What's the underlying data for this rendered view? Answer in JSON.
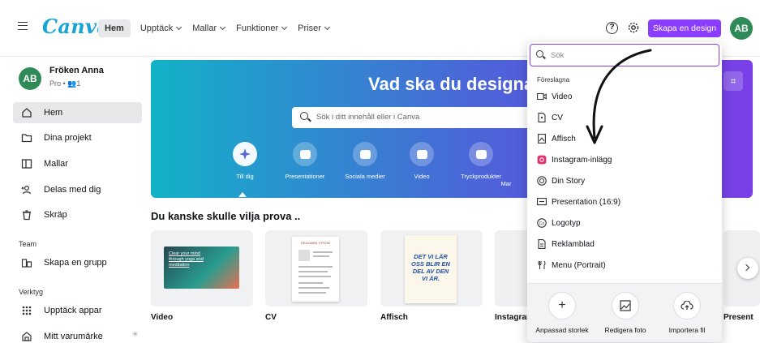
{
  "topbar": {
    "logo": "Canva",
    "nav": [
      {
        "label": "Hem",
        "active": true
      },
      {
        "label": "Upptäck",
        "has_chevron": true
      },
      {
        "label": "Mallar",
        "has_chevron": true
      },
      {
        "label": "Funktioner",
        "has_chevron": true
      },
      {
        "label": "Priser",
        "has_chevron": true
      }
    ],
    "help_icon": "?",
    "create_button": "Skapa en design",
    "avatar_initials": "AB"
  },
  "sidebar": {
    "user_initials": "AB",
    "user_name": "Fröken Anna",
    "user_sub": "Pro • 👥1",
    "items": [
      {
        "label": "Hem",
        "icon": "home-icon",
        "active": true
      },
      {
        "label": "Dina projekt",
        "icon": "folder-icon"
      },
      {
        "label": "Mallar",
        "icon": "templates-icon"
      },
      {
        "label": "Delas med dig",
        "icon": "shared-users-icon"
      },
      {
        "label": "Skräp",
        "icon": "trash-icon"
      }
    ],
    "team_heading": "Team",
    "team_items": [
      {
        "label": "Skapa en grupp",
        "icon": "team-building-icon"
      }
    ],
    "tools_heading": "Verktyg",
    "tools_items": [
      {
        "label": "Upptäck appar",
        "icon": "apps-grid-icon"
      },
      {
        "label": "Mitt varumärke",
        "icon": "brand-icon"
      }
    ]
  },
  "hero": {
    "title": "Vad ska du designa?",
    "search_placeholder": "Sök i ditt innehåll eller i Canva",
    "categories": [
      {
        "label": "Till dig",
        "icon": "sparkle-icon"
      },
      {
        "label": "Presentationer",
        "icon": "presentation-icon"
      },
      {
        "label": "Sociala medier",
        "icon": "heart-chat-icon"
      },
      {
        "label": "Video",
        "icon": "video-camera-icon"
      },
      {
        "label": "Tryckprodukter",
        "icon": "printer-icon"
      },
      {
        "label": "Mar"
      }
    ]
  },
  "suggestions": {
    "title": "Du kanske skulle vilja prova ..",
    "cards": [
      {
        "label": "Video",
        "thumb_text": "Clear your mind through yoga and meditation"
      },
      {
        "label": "CV",
        "thumb_text": "BENJAMIN STRÖM"
      },
      {
        "label": "Affisch",
        "thumb_text": "DET VI LÄR OSS BLIR EN DEL AV DEN VI ÄR."
      },
      {
        "label": "Instagram"
      },
      {
        "label": "Present"
      }
    ]
  },
  "dropdown": {
    "search_placeholder": "Sök",
    "heading": "Föreslagna",
    "items": [
      {
        "label": "Video",
        "icon": "video-icon"
      },
      {
        "label": "CV",
        "icon": "document-icon"
      },
      {
        "label": "Affisch",
        "icon": "poster-icon"
      },
      {
        "label": "Instagram-inlägg",
        "icon": "instagram-icon"
      },
      {
        "label": "Din Story",
        "icon": "story-icon"
      },
      {
        "label": "Presentation (16:9)",
        "icon": "presentation-icon"
      },
      {
        "label": "Logotyp",
        "icon": "logo-icon"
      },
      {
        "label": "Reklamblad",
        "icon": "flyer-icon"
      },
      {
        "label": "Menu (Portrait)",
        "icon": "menu-cutlery-icon"
      }
    ],
    "footer": [
      {
        "label": "Anpassad storlek",
        "icon": "plus-icon"
      },
      {
        "label": "Redigera foto",
        "icon": "edit-photo-icon"
      },
      {
        "label": "Importera fil",
        "icon": "upload-cloud-icon"
      }
    ]
  },
  "colors": {
    "accent": "#8b3dff",
    "logo": "#19a4d6",
    "avatar": "#2e8b57",
    "hero_start": "#12b2c8",
    "hero_end": "#7a3ee8"
  }
}
